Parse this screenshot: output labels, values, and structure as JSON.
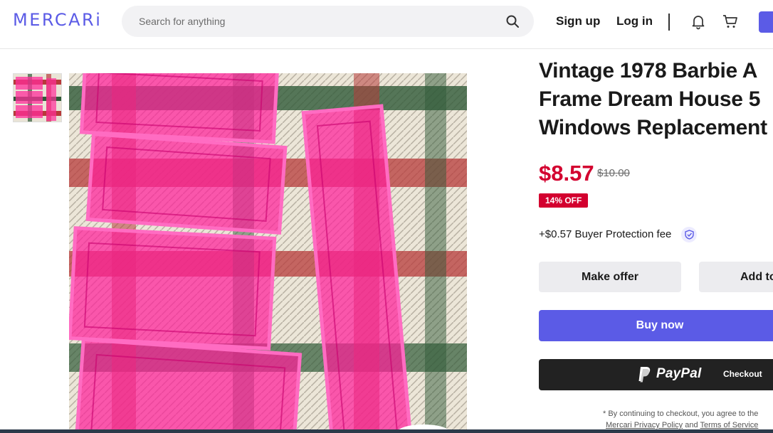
{
  "header": {
    "logo_text": "MERCARi",
    "search_placeholder": "Search for anything",
    "signup_label": "Sign up",
    "login_label": "Log in",
    "icons": [
      "search-icon",
      "bell-icon",
      "cart-icon"
    ],
    "accent_color": "#5b5be6"
  },
  "product": {
    "title": "Vintage 1978 Barbie A Frame Dream House 5 Windows Replacement",
    "price": "$8.57",
    "original_price": "$10.00",
    "discount_badge": "14% OFF",
    "buyer_protection_fee": "+$0.57 Buyer Protection fee",
    "price_color": "#d3002f"
  },
  "actions": {
    "make_offer_label": "Make offer",
    "add_to_cart_label": "Add to",
    "buy_now_label": "Buy now",
    "paypal_brand": "PayPal",
    "paypal_checkout_label": "Checkout"
  },
  "disclaimer": {
    "line1": "* By continuing to checkout, you agree to the",
    "privacy_link": "Mercari Privacy Policy",
    "and_text": " and ",
    "terms_link": "Terms of Service"
  }
}
